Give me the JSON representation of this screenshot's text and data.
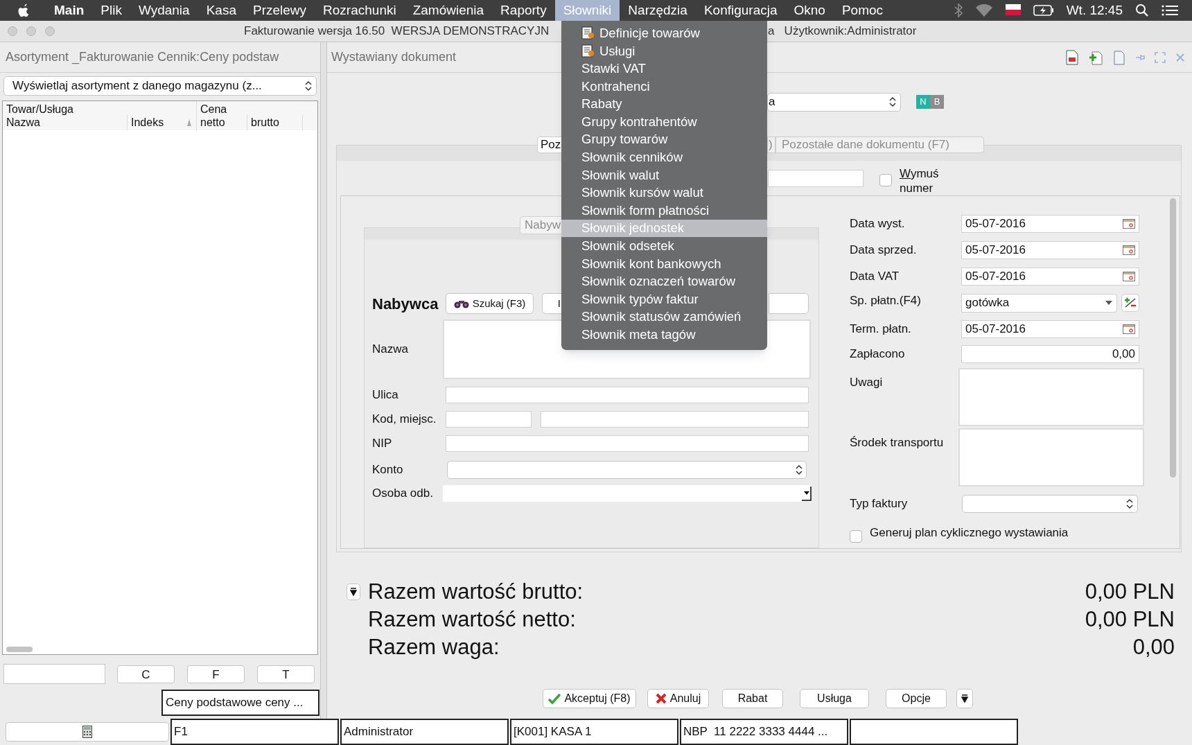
{
  "menubar": {
    "items": [
      {
        "label": "Main",
        "kind": "app",
        "selected": false
      },
      {
        "label": "Plik",
        "kind": "menu",
        "selected": false
      },
      {
        "label": "Wydania",
        "kind": "menu",
        "selected": false
      },
      {
        "label": "Kasa",
        "kind": "menu",
        "selected": false
      },
      {
        "label": "Przelewy",
        "kind": "menu",
        "selected": false
      },
      {
        "label": "Rozrachunki",
        "kind": "menu",
        "selected": false
      },
      {
        "label": "Zamówienia",
        "kind": "menu",
        "selected": false
      },
      {
        "label": "Raporty",
        "kind": "menu",
        "selected": false
      },
      {
        "label": "Słowniki",
        "kind": "menu",
        "selected": true
      },
      {
        "label": "Narzędzia",
        "kind": "menu",
        "selected": false
      },
      {
        "label": "Konfiguracja",
        "kind": "menu",
        "selected": false
      },
      {
        "label": "Okno",
        "kind": "menu",
        "selected": false
      },
      {
        "label": "Pomoc",
        "kind": "menu",
        "selected": false
      }
    ],
    "clock": "Wt. 12:45"
  },
  "window": {
    "title_left": "Fakturowanie wersja 16.50  WERSJA DEMONSTRACYJN",
    "title_right": "a   Użytkownik:Administrator"
  },
  "left_panel": {
    "title": "Asortyment _Fakturowanie Cennik:Ceny podstaw",
    "filter": "Wyświetlaj asortyment z danego magazynu (z...",
    "group_headers": [
      "Towar/Usługa",
      "Cena"
    ],
    "columns": [
      "Nazwa",
      "Indeks",
      "netto",
      "brutto"
    ],
    "buttons": [
      "C",
      "F",
      "T"
    ],
    "price_list": "Ceny podstawowe ceny ..."
  },
  "document": {
    "title": "Wystawiany dokument",
    "type_combo": "a",
    "badges": [
      "N",
      "B"
    ],
    "tabs": [
      {
        "label": "Poz",
        "selected": true
      },
      {
        "label": ")",
        "selected": false
      },
      {
        "label": "Pozostałe dane dokumentu (F7)",
        "selected": false
      }
    ],
    "force_number": {
      "label": "Wymuś numer",
      "checked": false
    },
    "buyer_tab": "Nabyw",
    "buyer": {
      "heading": "Nabywca",
      "search_button": "Szukaj (F3)",
      "second_button": "I",
      "fields": [
        {
          "label": "Nazwa",
          "kind": "textarea"
        },
        {
          "label": "Ulica",
          "kind": "text"
        },
        {
          "label": "Kod, miejsc.",
          "kind": "split"
        },
        {
          "label": "NIP",
          "kind": "text"
        },
        {
          "label": "Konto",
          "kind": "combo"
        },
        {
          "label": "Osoba odb.",
          "kind": "dropdown"
        }
      ]
    },
    "details": [
      {
        "label": "Data wyst.",
        "kind": "date",
        "value": "05-07-2016"
      },
      {
        "label": "Data sprzed.",
        "kind": "date",
        "value": "05-07-2016"
      },
      {
        "label": "Data VAT",
        "kind": "date",
        "value": "05-07-2016"
      },
      {
        "label": "Sp. płatn.(F4)",
        "kind": "select",
        "value": "gotówka"
      },
      {
        "label": "Term. płatn.",
        "kind": "date",
        "value": "05-07-2016"
      },
      {
        "label": "Zapłacono",
        "kind": "amount",
        "value": "0,00"
      },
      {
        "label": "Uwagi",
        "kind": "textarea"
      },
      {
        "label": "Środek transportu",
        "kind": "textarea"
      },
      {
        "label": "Typ faktury",
        "kind": "combo"
      }
    ],
    "cyclic": {
      "label": "Generuj plan cyklicznego wystawiania",
      "checked": false
    },
    "totals": [
      {
        "label": "Razem wartość brutto:",
        "value": "0,00 PLN"
      },
      {
        "label": "Razem wartość netto:",
        "value": "0,00 PLN"
      },
      {
        "label": "Razem waga:",
        "value": "0,00"
      }
    ],
    "buttons": [
      {
        "label": "Akceptuj (F8)",
        "kind": "accept"
      },
      {
        "label": "Anuluj",
        "kind": "cancel"
      },
      {
        "label": "Rabat",
        "kind": "plain"
      },
      {
        "label": "Usługa",
        "kind": "plain"
      },
      {
        "label": "Opcje",
        "kind": "plain"
      }
    ]
  },
  "menu": {
    "items": [
      {
        "label": "Definicje towarów",
        "has_icon": true,
        "highlighted": false
      },
      {
        "label": "Usługi",
        "has_icon": true,
        "highlighted": false
      },
      {
        "label": "Stawki VAT",
        "has_icon": false,
        "highlighted": false
      },
      {
        "label": "Kontrahenci",
        "has_icon": false,
        "highlighted": false
      },
      {
        "label": "Rabaty",
        "has_icon": false,
        "highlighted": false
      },
      {
        "label": "Grupy kontrahentów",
        "has_icon": false,
        "highlighted": false
      },
      {
        "label": "Grupy towarów",
        "has_icon": false,
        "highlighted": false
      },
      {
        "label": "Słownik cenników",
        "has_icon": false,
        "highlighted": false
      },
      {
        "label": "Słownik walut",
        "has_icon": false,
        "highlighted": false
      },
      {
        "label": "Słownik kursów walut",
        "has_icon": false,
        "highlighted": false
      },
      {
        "label": "Słownik form płatności",
        "has_icon": false,
        "highlighted": false
      },
      {
        "label": "Słownik jednostek",
        "has_icon": false,
        "highlighted": true
      },
      {
        "label": "Słownik odsetek",
        "has_icon": false,
        "highlighted": false
      },
      {
        "label": "Słownik kont bankowych",
        "has_icon": false,
        "highlighted": false
      },
      {
        "label": "Słownik oznaczeń towarów",
        "has_icon": false,
        "highlighted": false
      },
      {
        "label": "Słownik typów faktur",
        "has_icon": false,
        "highlighted": false
      },
      {
        "label": "Słownik statusów zamówień",
        "has_icon": false,
        "highlighted": false
      },
      {
        "label": "Słownik meta tagów",
        "has_icon": false,
        "highlighted": false
      }
    ]
  },
  "status_bar": {
    "cells": [
      "F1",
      "Administrator",
      "[K001] KASA 1",
      "NBP  11 2222 3333 4444 ..."
    ]
  }
}
